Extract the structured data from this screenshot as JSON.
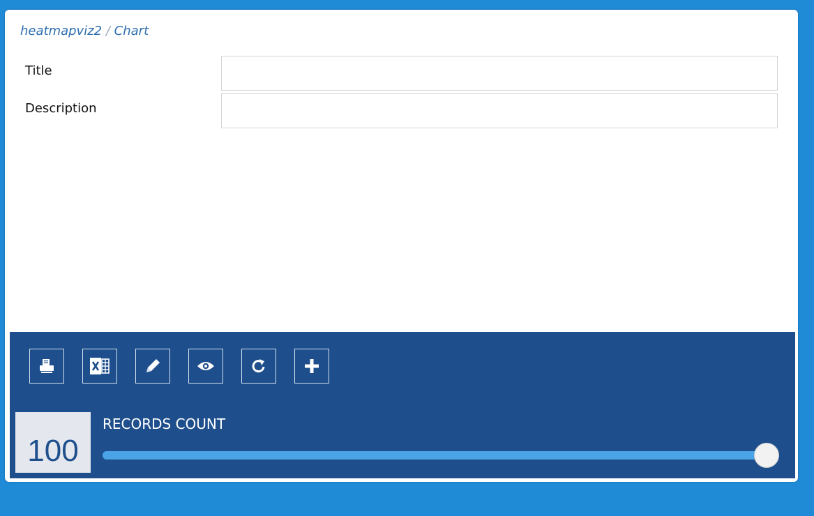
{
  "breadcrumb": {
    "module": "heatmapviz2",
    "separator": "/",
    "page": "Chart"
  },
  "form": {
    "title_label": "Title",
    "title_value": "",
    "description_label": "Description",
    "description_value": ""
  },
  "toolbar": {
    "buttons": [
      {
        "icon": "print-icon"
      },
      {
        "icon": "excel-icon"
      },
      {
        "icon": "pencil-icon"
      },
      {
        "icon": "eye-icon"
      },
      {
        "icon": "refresh-icon"
      },
      {
        "icon": "plus-icon"
      }
    ]
  },
  "records": {
    "count": "100",
    "label": "RECORDS COUNT",
    "slider_level": 1.0
  },
  "colors": {
    "page_background": "#1f8ad6",
    "toolbar_background": "#1e4f8c",
    "breadcrumb_text": "#2e6eb0",
    "slider_track": "#4a9ee0"
  }
}
